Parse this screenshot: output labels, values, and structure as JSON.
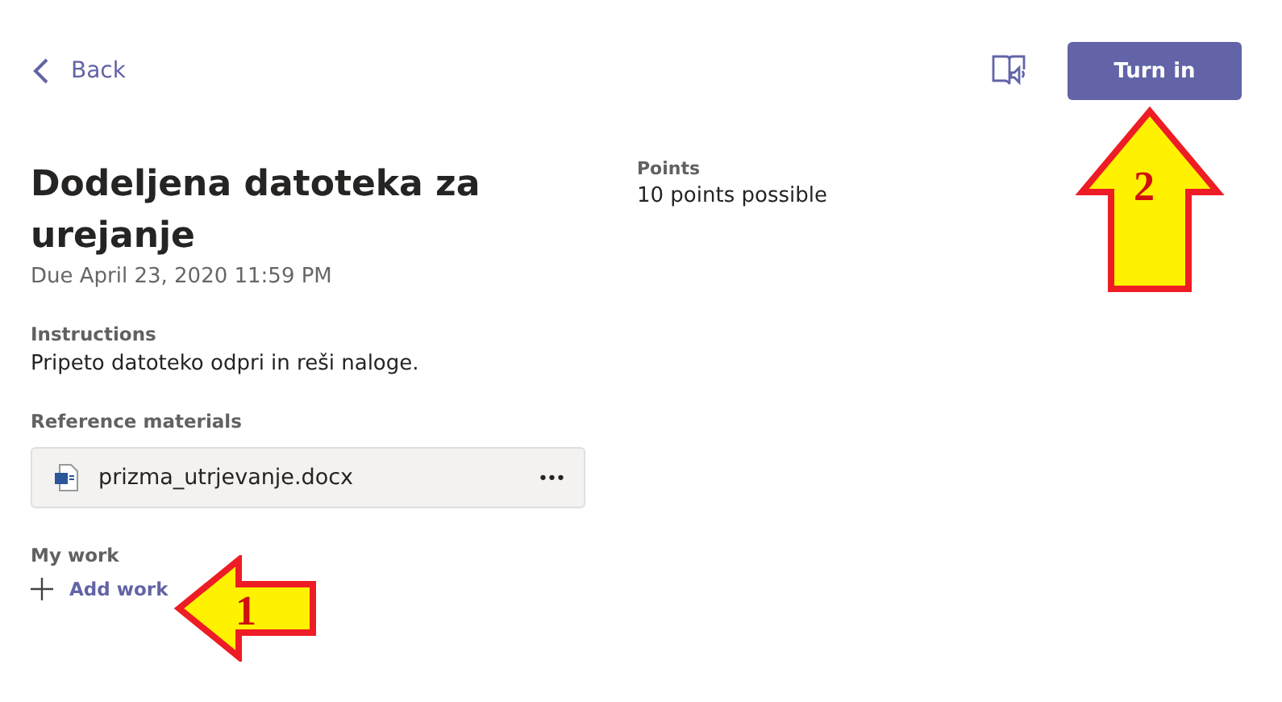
{
  "header": {
    "back": "Back",
    "turn_in": "Turn in"
  },
  "assignment": {
    "title": "Dodeljena datoteka za urejanje",
    "due": "Due April 23, 2020 11:59 PM"
  },
  "points": {
    "label": "Points",
    "value": "10 points possible"
  },
  "instructions": {
    "label": "Instructions",
    "text": "Pripeto datoteko odpri in reši naloge."
  },
  "reference": {
    "label": "Reference materials",
    "files": [
      {
        "name": "prizma_utrjevanje.docx",
        "menu": "•••"
      }
    ]
  },
  "my_work": {
    "label": "My work",
    "add": "Add work"
  },
  "annotations": [
    {
      "kind": "left",
      "number": "1"
    },
    {
      "kind": "up",
      "number": "2"
    }
  ]
}
